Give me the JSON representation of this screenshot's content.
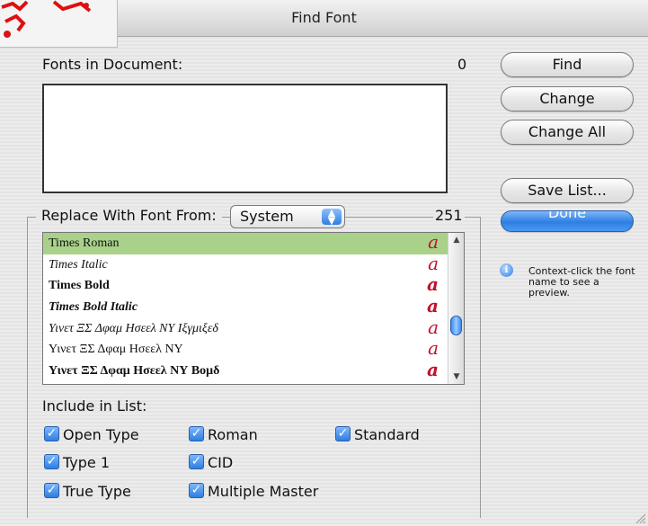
{
  "window": {
    "title": "Find Font"
  },
  "document_fonts": {
    "label": "Fonts in Document:",
    "count": "0"
  },
  "buttons": {
    "find": "Find",
    "change": "Change",
    "change_all": "Change All",
    "save_list": "Save List...",
    "done": "Done"
  },
  "replace": {
    "label": "Replace With Font From:",
    "source": "System",
    "count": "251"
  },
  "font_list": [
    {
      "name": "Times Roman",
      "style": "roman",
      "sample": "a",
      "selected": true
    },
    {
      "name": "Times Italic",
      "style": "italic",
      "sample": "a",
      "selected": false
    },
    {
      "name": "Times Bold",
      "style": "bold",
      "sample": "a",
      "selected": false
    },
    {
      "name": "Times Bold Italic",
      "style": "bolditalic",
      "sample": "a",
      "selected": false
    },
    {
      "name": "Υινετ ΞΣ Δφαμ Ησεελ ΝΥ Ιξγμιξεδ",
      "style": "italic",
      "sample": "a",
      "selected": false
    },
    {
      "name": "Υινετ ΞΣ Δφαμ Ησεελ ΝΥ",
      "style": "roman",
      "sample": "a",
      "selected": false
    },
    {
      "name": "Υινετ ΞΣ Δφαμ Ησεελ ΝΥ Βομδ",
      "style": "bold",
      "sample": "a",
      "selected": false
    }
  ],
  "include": {
    "label": "Include in List:",
    "options": [
      {
        "label": "Open Type",
        "checked": true
      },
      {
        "label": "Type 1",
        "checked": true
      },
      {
        "label": "True Type",
        "checked": true
      },
      {
        "label": "Roman",
        "checked": true
      },
      {
        "label": "CID",
        "checked": true
      },
      {
        "label": "Multiple Master",
        "checked": true
      },
      {
        "label": "Standard",
        "checked": true
      }
    ]
  },
  "info": {
    "text": "Context-click the font name to see a preview.",
    "icon": "info-icon"
  },
  "colors": {
    "accent": "#2d7fe0",
    "selection": "#a9d18a",
    "sample": "#c2102b"
  }
}
